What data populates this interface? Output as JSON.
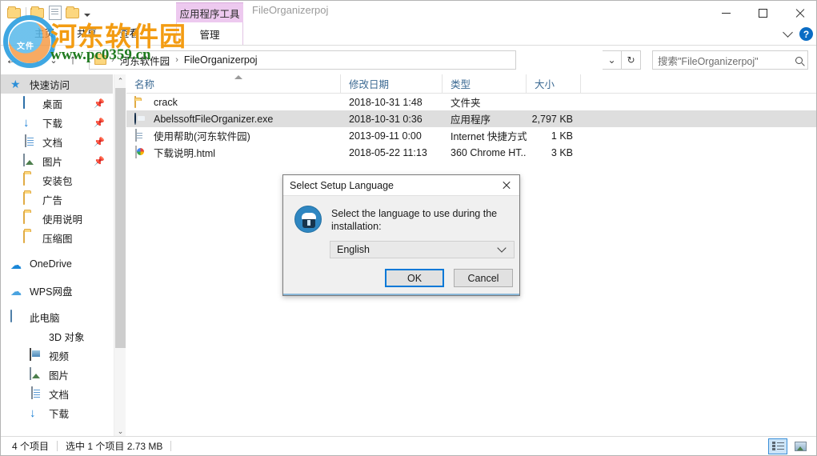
{
  "window": {
    "document_title": "FileOrganizerpoj",
    "contextual_group": "应用程序工具",
    "contextual_tab": "管理",
    "minimize": "—",
    "maximize": "□",
    "close": "✕",
    "help": "?",
    "ribbon_collapse": "⌄"
  },
  "ribbon": {
    "tabs": [
      {
        "label": "主页"
      },
      {
        "label": "共享"
      },
      {
        "label": "查看"
      }
    ]
  },
  "address": {
    "back": "←",
    "forward": "→",
    "recent": "⌄",
    "up": "↑",
    "crumbs": [
      "河东软件园",
      "FileOrganizerpoj"
    ],
    "separator": "›",
    "dropdown": "⌄",
    "refresh": "↻"
  },
  "search": {
    "placeholder": "搜索\"FileOrganizerpoj\"",
    "value": "搜索\"FileOrganizerpoj\""
  },
  "sidebar": {
    "items": [
      {
        "label": "快速访问",
        "icon": "star-icon",
        "level": 0,
        "selected": true,
        "pinned": false
      },
      {
        "label": "桌面",
        "icon": "desktop-icon",
        "level": 1,
        "selected": false,
        "pinned": true
      },
      {
        "label": "下载",
        "icon": "download-icon",
        "level": 1,
        "selected": false,
        "pinned": true
      },
      {
        "label": "文档",
        "icon": "documents-icon",
        "level": 1,
        "selected": false,
        "pinned": true
      },
      {
        "label": "图片",
        "icon": "pictures-icon",
        "level": 1,
        "selected": false,
        "pinned": true
      },
      {
        "label": "安装包",
        "icon": "folder-icon",
        "level": 1,
        "selected": false,
        "pinned": false
      },
      {
        "label": "广告",
        "icon": "folder-icon",
        "level": 1,
        "selected": false,
        "pinned": false
      },
      {
        "label": "使用说明",
        "icon": "folder-icon",
        "level": 1,
        "selected": false,
        "pinned": false
      },
      {
        "label": "压缩图",
        "icon": "folder-icon",
        "level": 1,
        "selected": false,
        "pinned": false
      },
      {
        "label": "OneDrive",
        "icon": "onedrive-cloud-icon",
        "level": 0,
        "selected": false,
        "pinned": false,
        "gap_before": true
      },
      {
        "label": "WPS网盘",
        "icon": "wps-cloud-icon",
        "level": 0,
        "selected": false,
        "pinned": false,
        "gap_before": true
      },
      {
        "label": "此电脑",
        "icon": "this-pc-icon",
        "level": 0,
        "selected": false,
        "pinned": false,
        "gap_before": true
      },
      {
        "label": "3D 对象",
        "icon": "3d-objects-icon",
        "level": 2,
        "selected": false,
        "pinned": false
      },
      {
        "label": "视频",
        "icon": "videos-icon",
        "level": 2,
        "selected": false,
        "pinned": false
      },
      {
        "label": "图片",
        "icon": "pictures-icon",
        "level": 2,
        "selected": false,
        "pinned": false
      },
      {
        "label": "文档",
        "icon": "documents-icon",
        "level": 2,
        "selected": false,
        "pinned": false
      },
      {
        "label": "下载",
        "icon": "download-icon",
        "level": 2,
        "selected": false,
        "pinned": false
      }
    ],
    "scroll_up": "⌃",
    "scroll_down": "⌄",
    "pin_glyph": "📌"
  },
  "filelist": {
    "columns": [
      {
        "label": "名称"
      },
      {
        "label": "修改日期"
      },
      {
        "label": "类型"
      },
      {
        "label": "大小"
      }
    ],
    "sort_column": "名称",
    "rows": [
      {
        "name": "crack",
        "date": "2018-10-31 1:48",
        "type": "文件夹",
        "size": "",
        "icon": "folder-icon",
        "selected": false
      },
      {
        "name": "AbelssoftFileOrganizer.exe",
        "date": "2018-10-31 0:36",
        "type": "应用程序",
        "size": "2,797 KB",
        "icon": "application-icon",
        "selected": true
      },
      {
        "name": "使用帮助(河东软件园)",
        "date": "2013-09-11 0:00",
        "type": "Internet 快捷方式",
        "size": "1 KB",
        "icon": "internet-shortcut-icon",
        "selected": false
      },
      {
        "name": "下载说明.html",
        "date": "2018-05-22 11:13",
        "type": "360 Chrome HT...",
        "size": "3 KB",
        "icon": "html-file-icon",
        "selected": false
      }
    ]
  },
  "dialog": {
    "title": "Select Setup Language",
    "close": "✕",
    "message": "Select the language to use during the installation:",
    "language_value": "English",
    "ok_label": "OK",
    "cancel_label": "Cancel"
  },
  "statusbar": {
    "item_count": "4 个项目",
    "selection": "选中 1 个项目  2.73 MB"
  },
  "watermark": {
    "site_name": "河东软件园",
    "url": "www.pc0359.cn",
    "logo_text": "文件"
  }
}
